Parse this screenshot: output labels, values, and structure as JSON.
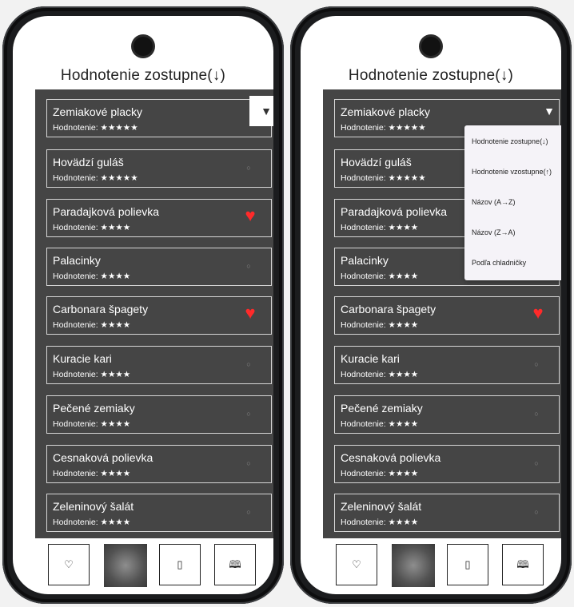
{
  "screens": [
    {
      "title": "Hodnotenie zostupne(↓)",
      "items": [
        {
          "name": "Zemiakové placky",
          "rating": "Hodnotenie: ★★★★★",
          "icon": "none"
        },
        {
          "name": "Hovädzí guláš",
          "rating": "Hodnotenie: ★★★★★",
          "icon": "circle-icon"
        },
        {
          "name": "Paradajková polievka",
          "rating": "Hodnotenie: ★★★★",
          "icon": "heart-icon"
        },
        {
          "name": "Palacinky",
          "rating": "Hodnotenie: ★★★★",
          "icon": "circle-icon"
        },
        {
          "name": "Carbonara špagety",
          "rating": "Hodnotenie: ★★★★",
          "icon": "heart-icon"
        },
        {
          "name": "Kuracie kari",
          "rating": "Hodnotenie: ★★★★",
          "icon": "circle-icon"
        },
        {
          "name": "Pečené zemiaky",
          "rating": "Hodnotenie: ★★★★",
          "icon": "circle-icon"
        },
        {
          "name": "Cesnaková polievka",
          "rating": "Hodnotenie: ★★★★",
          "icon": "circle-icon"
        },
        {
          "name": "Zeleninový šalát",
          "rating": "Hodnotenie: ★★★★",
          "icon": "circle-icon"
        }
      ]
    },
    {
      "title": "Hodnotenie zostupne(↓)",
      "items": [
        {
          "name": "Zemiakové placky",
          "rating": "Hodnotenie: ★★★★★",
          "icon": "none"
        },
        {
          "name": "Hovädzí guláš",
          "rating": "Hodnotenie: ★★★★★",
          "icon": "none"
        },
        {
          "name": "Paradajková polievka",
          "rating": "Hodnotenie: ★★★★",
          "icon": "none"
        },
        {
          "name": "Palacinky",
          "rating": "Hodnotenie: ★★★★",
          "icon": "none"
        },
        {
          "name": "Carbonara špagety",
          "rating": "Hodnotenie: ★★★★",
          "icon": "heart-icon"
        },
        {
          "name": "Kuracie kari",
          "rating": "Hodnotenie: ★★★★",
          "icon": "circle-icon"
        },
        {
          "name": "Pečené zemiaky",
          "rating": "Hodnotenie: ★★★★",
          "icon": "circle-icon"
        },
        {
          "name": "Cesnaková polievka",
          "rating": "Hodnotenie: ★★★★",
          "icon": "circle-icon"
        },
        {
          "name": "Zeleninový šalát",
          "rating": "Hodnotenie: ★★★★",
          "icon": "circle-icon"
        }
      ],
      "sort_menu": [
        "Hodnotenie zostupne(↓)",
        "Hodnotenie vzostupne(↑)",
        "Názov (A→Z)",
        "Názov (Z→A)",
        "Podľa chladničky"
      ]
    }
  ],
  "icons": {
    "filter": "▼",
    "heart": "♥",
    "circle": "○",
    "favorites": "♡",
    "fridge": "▯",
    "book": "🕮"
  },
  "colors": {
    "list_background": "#454545",
    "heart": "#ff2a2a"
  }
}
